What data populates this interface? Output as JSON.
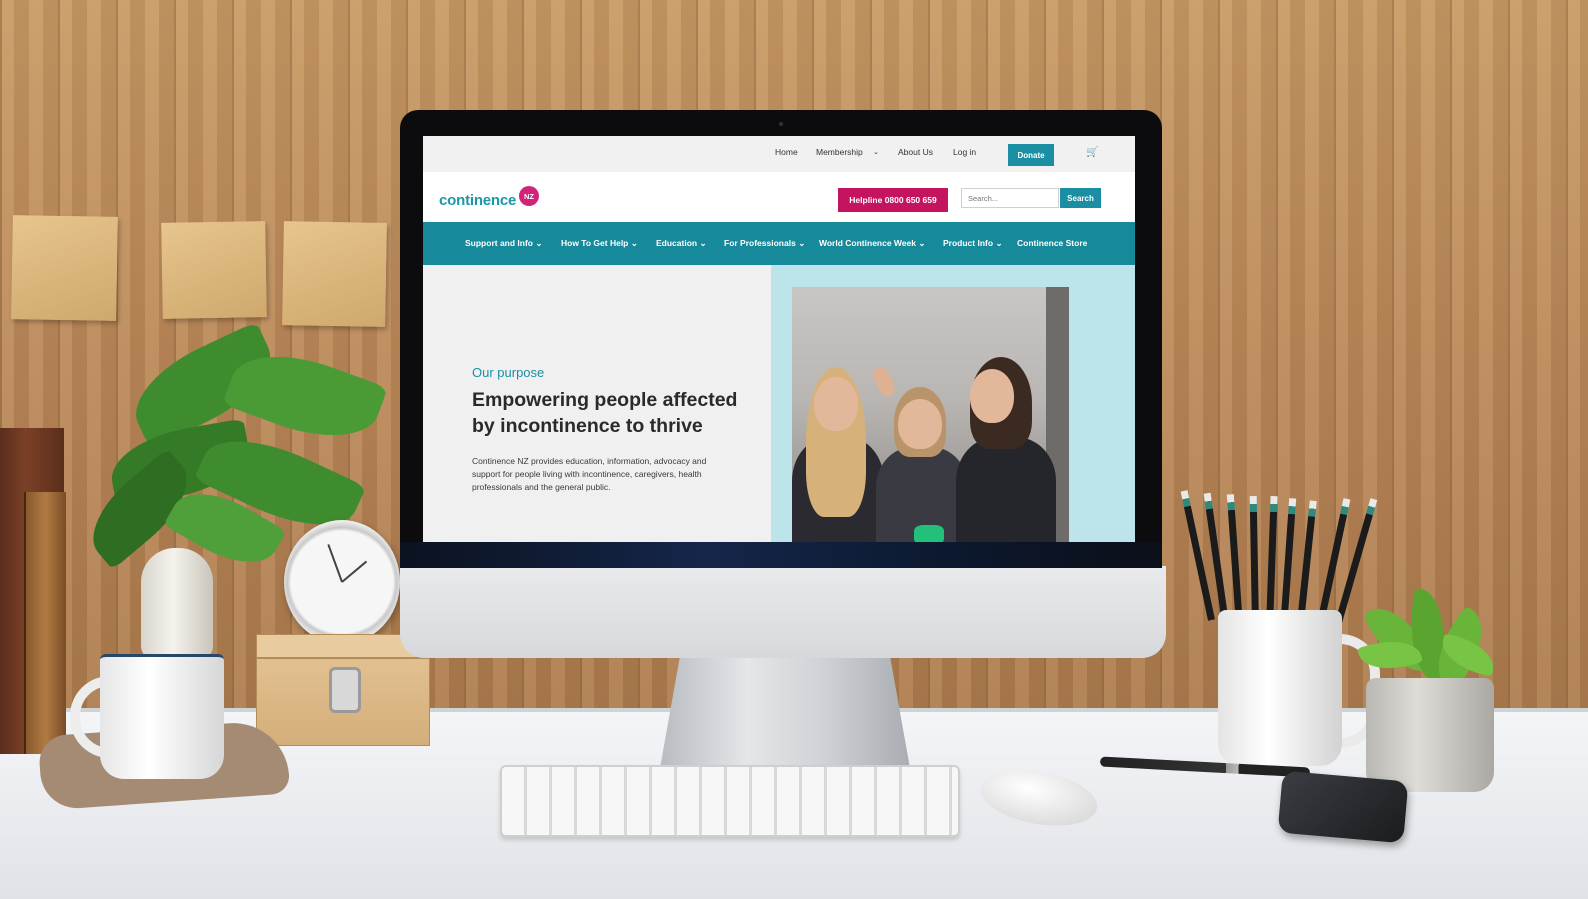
{
  "site": {
    "logo_text": "continence",
    "logo_badge": "NZ",
    "topbar": {
      "links": [
        "Home",
        "Membership",
        "About Us",
        "Log in"
      ],
      "membership_chevron": "chevron-down-icon",
      "donate_label": "Donate",
      "cart_icon": "cart-icon"
    },
    "header": {
      "helpline_label": "Helpline 0800 650 659",
      "search_placeholder": "Search...",
      "search_button_label": "Search"
    },
    "nav": {
      "items": [
        {
          "label": "Support and Info",
          "has_dropdown": true
        },
        {
          "label": "How To Get Help",
          "has_dropdown": true
        },
        {
          "label": "Education",
          "has_dropdown": true
        },
        {
          "label": "For Professionals",
          "has_dropdown": true
        },
        {
          "label": "World Continence Week",
          "has_dropdown": true
        },
        {
          "label": "Product Info",
          "has_dropdown": true
        },
        {
          "label": "Continence Store",
          "has_dropdown": false
        }
      ]
    },
    "hero": {
      "eyebrow": "Our purpose",
      "headline": "Empowering people affected by incontinence to thrive",
      "description": "Continence NZ provides education, information, advocacy and support for people living with incontinence, caregivers, health professionals and the general public."
    },
    "colors": {
      "teal": "#1a8fa3",
      "nav_teal": "#16899b",
      "magenta": "#c4145f",
      "hero_right_bg": "#bde4ea"
    }
  }
}
